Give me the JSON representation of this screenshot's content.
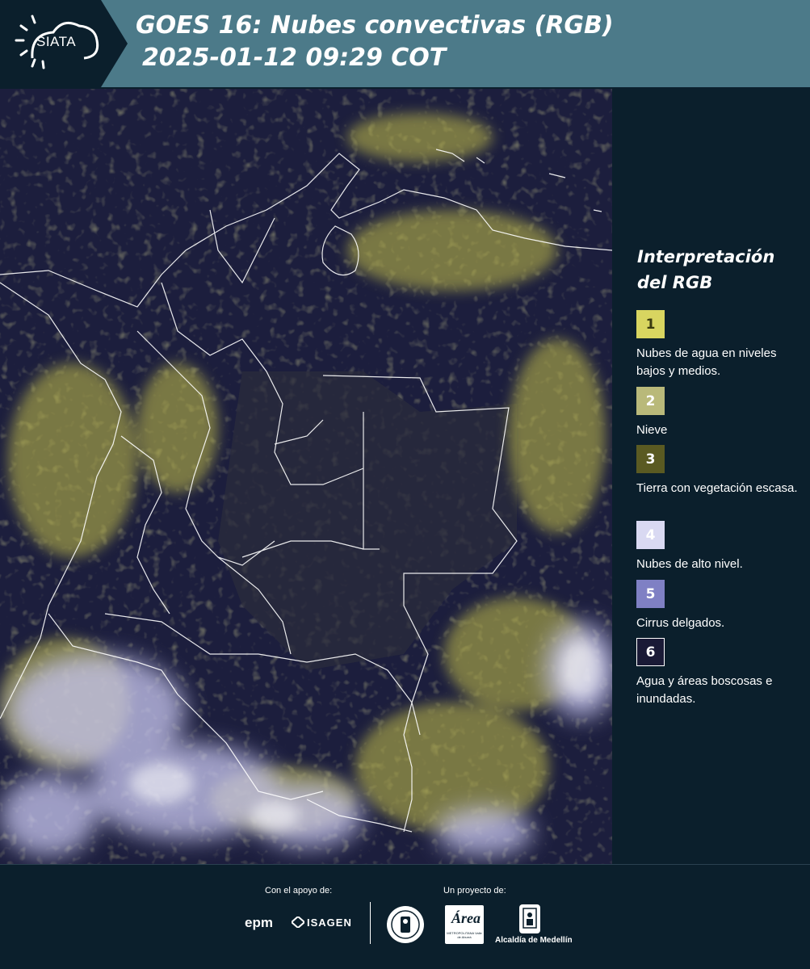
{
  "header": {
    "logo_text": "SIATA",
    "title_line1": "GOES 16: Nubes convectivas (RGB)",
    "title_line2": "2025-01-12 09:29 COT"
  },
  "legend": {
    "title": "Interpretación del RGB",
    "items": [
      {
        "number": "1",
        "color": "#d8d560",
        "text_color": "#3a3a10",
        "description": "Nubes de agua en niveles bajos y medios."
      },
      {
        "number": "2",
        "color": "#b9b97a",
        "text_color": "#ffffff",
        "description": "Nieve"
      },
      {
        "number": "3",
        "color": "#5a5a22",
        "text_color": "#ffffff",
        "description": "Tierra con vegetación escasa."
      },
      {
        "number": "4",
        "color": "#d9d9f2",
        "text_color": "#ffffff",
        "description": "Nubes de alto nivel."
      },
      {
        "number": "5",
        "color": "#7f80c4",
        "text_color": "#ffffff",
        "description": "Cirrus delgados."
      },
      {
        "number": "6",
        "color": "#1a1a36",
        "text_color": "#ffffff",
        "description": "Agua y áreas boscosas e inundadas."
      }
    ]
  },
  "footer": {
    "support_label": "Con el apoyo de:",
    "project_label": "Un proyecto de:",
    "epm_logo": "epm",
    "isagen_logo": "ISAGEN",
    "amva_logo": "Área",
    "amva_subtext": "METROPOLITANA Valle de Aburrá",
    "alcaldia_logo": "Alcaldía de Medellín",
    "colors": {
      "background": "#0b1f2c",
      "header": "#4c7a89"
    }
  }
}
